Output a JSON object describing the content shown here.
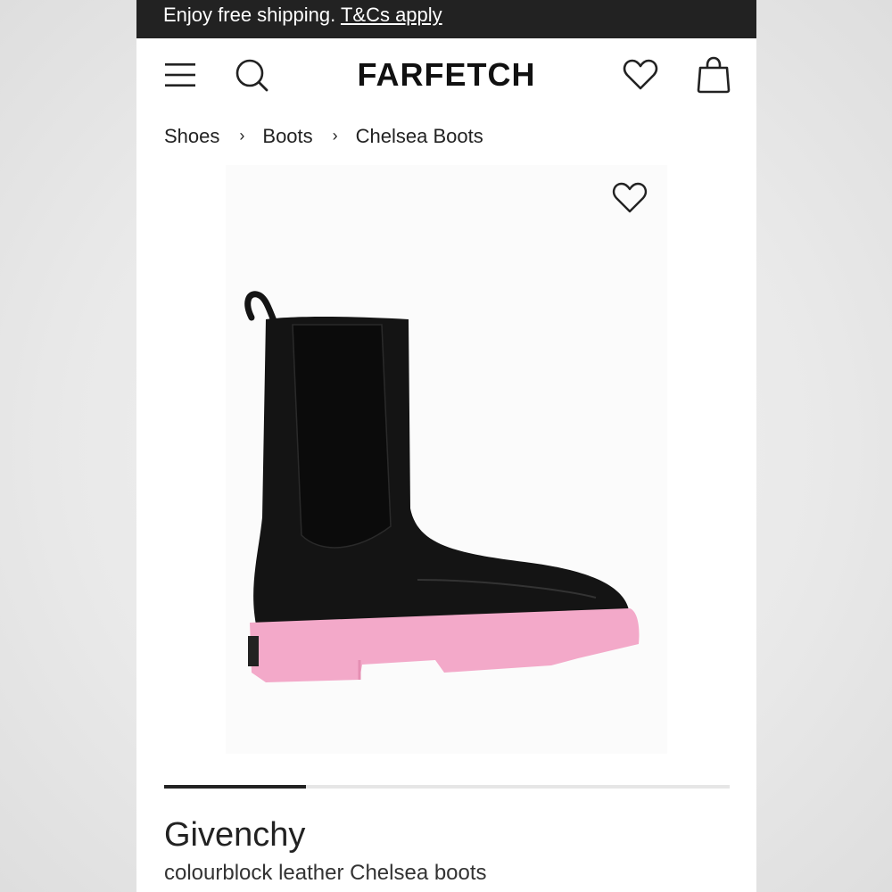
{
  "promo": {
    "text": "Enjoy free shipping. ",
    "link": "T&Cs apply"
  },
  "header": {
    "logo": "FARFETCH",
    "icons": [
      "menu-icon",
      "search-icon",
      "heart-icon",
      "shopping-bag-icon"
    ]
  },
  "breadcrumb": [
    "Shoes",
    "Boots",
    "Chelsea Boots"
  ],
  "product": {
    "image_icon": "heart-icon",
    "brand": "Givenchy",
    "name": "colourblock leather Chelsea boots",
    "gallery_progress": 0.25,
    "colors": {
      "upper": "#141414",
      "sole": "#f3a9c9"
    }
  }
}
